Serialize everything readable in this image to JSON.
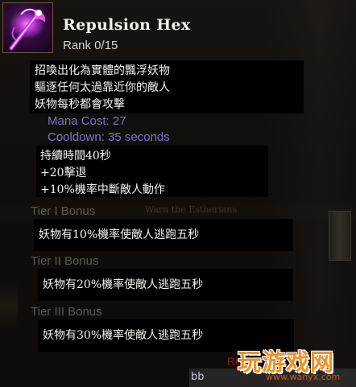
{
  "skill": {
    "name": "Repulsion Hex",
    "rank": "Rank 0/15",
    "icon": "hex-staff-icon"
  },
  "description": {
    "lines": [
      "招喚出化為實體的飄浮妖物",
      "驅逐任何太過靠近你的敵人",
      "妖物每秒都會攻擊"
    ]
  },
  "stats": {
    "mana_cost": "Mana Cost: 27",
    "cooldown": "Cooldown: 35 seconds"
  },
  "effects": {
    "lines": [
      "持續時間40秒",
      "+20擊退",
      "+10%機率中斷敵人動作"
    ]
  },
  "tiers": [
    {
      "label": "Tier I Bonus",
      "text": "妖物有10%機率使敵人逃跑五秒"
    },
    {
      "label": "Tier II Bonus",
      "text": "妖物有20%機率使敵人逃跑五秒"
    },
    {
      "label": "Tier III Bonus",
      "text": "妖物有30%機率使敵人逃跑五秒"
    }
  ],
  "background": {
    "faded_text": "Warn the Estherians",
    "requirement_text": "Rec"
  },
  "watermark": {
    "text": "玩游戏网",
    "url": "www.wanyx.com"
  },
  "footer": {
    "text": "bb"
  },
  "colors": {
    "title": "#f2efe8",
    "stat_text": "#8070c8",
    "tier_label": "#5e5a52",
    "box_bg": "#000000",
    "icon_glow": "#e040ff",
    "watermark": "#f29020"
  }
}
